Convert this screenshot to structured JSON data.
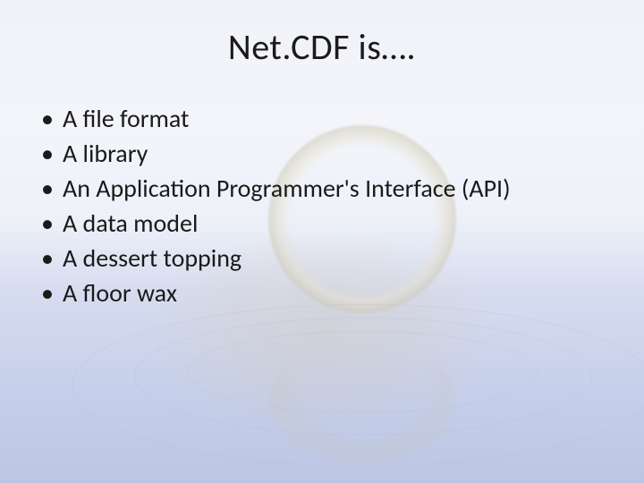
{
  "title": "Net.CDF is….",
  "bullets": [
    "A file format",
    "A library",
    "An Application Programmer's Interface (API)",
    "A data model",
    "A dessert topping",
    "A floor wax"
  ]
}
